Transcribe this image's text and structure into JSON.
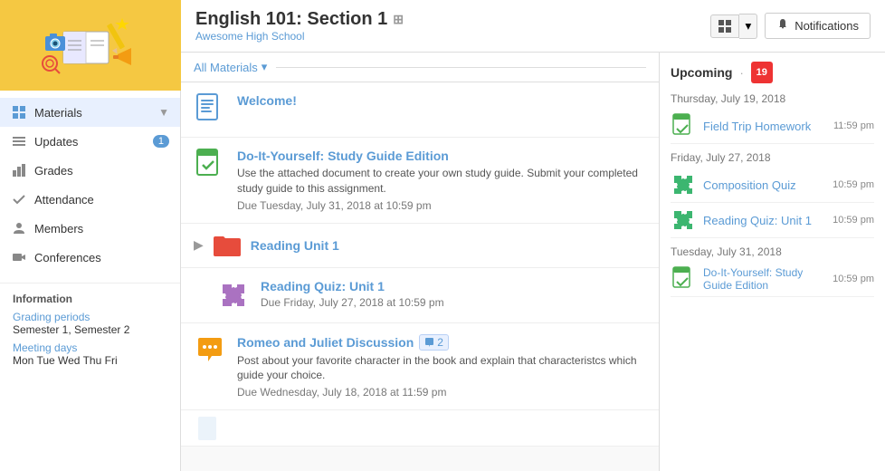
{
  "sidebar": {
    "nav": [
      {
        "id": "materials",
        "label": "Materials",
        "icon": "grid-icon",
        "badge": null,
        "active": true,
        "hasArrow": true
      },
      {
        "id": "updates",
        "label": "Updates",
        "icon": "list-icon",
        "badge": "1",
        "active": false
      },
      {
        "id": "grades",
        "label": "Grades",
        "icon": "chart-icon",
        "badge": null,
        "active": false
      },
      {
        "id": "attendance",
        "label": "Attendance",
        "icon": "check-icon",
        "badge": null,
        "active": false
      },
      {
        "id": "members",
        "label": "Members",
        "icon": "person-icon",
        "badge": null,
        "active": false
      },
      {
        "id": "conferences",
        "label": "Conferences",
        "icon": "video-icon",
        "badge": null,
        "active": false
      }
    ],
    "info_title": "Information",
    "grading_periods_label": "Grading periods",
    "grading_periods_value": "Semester 1, Semester 2",
    "meeting_days_label": "Meeting days",
    "meeting_days_value": "Mon Tue Wed Thu Fri"
  },
  "header": {
    "course_title": "English 101: Section 1",
    "school_name": "Awesome High School",
    "grid_button_label": "grid-view",
    "notifications_label": "Notifications"
  },
  "materials": {
    "all_materials_label": "All Materials",
    "items": [
      {
        "id": "welcome",
        "type": "document",
        "title": "Welcome!",
        "desc": null,
        "due": null,
        "icon_color": "#5b9bd5",
        "comment_count": null
      },
      {
        "id": "study-guide",
        "type": "assignment",
        "title": "Do-It-Yourself: Study Guide Edition",
        "desc": "Use the attached document to create your own study guide. Submit your completed study guide to this assignment.",
        "due": "Due Tuesday, July 31, 2018 at 10:59 pm",
        "icon_color": "#4caf50",
        "comment_count": null
      },
      {
        "id": "reading-unit-1",
        "type": "folder",
        "title": "Reading Unit 1",
        "desc": null,
        "due": null,
        "icon_color": "#e74c3c",
        "comment_count": null
      },
      {
        "id": "reading-quiz-unit-1",
        "type": "quiz",
        "title": "Reading Quiz: Unit 1",
        "desc": null,
        "due": "Due Friday, July 27, 2018 at 10:59 pm",
        "icon_color": "#9b59b6",
        "comment_count": null
      },
      {
        "id": "romeo-juliet",
        "type": "discussion",
        "title": "Romeo and Juliet Discussion",
        "desc": "Post about your favorite character in the book and explain that characteristcs which guide your choice.",
        "due": "Due Wednesday, July 18, 2018 at 11:59 pm",
        "icon_color": "#f39c12",
        "comment_count": "2"
      }
    ]
  },
  "upcoming": {
    "title": "Upcoming",
    "calendar_day": "19",
    "dates": [
      {
        "date": "Thursday, July 19, 2018",
        "items": [
          {
            "title": "Field Trip Homework",
            "time": "11:59 pm",
            "type": "assignment"
          }
        ]
      },
      {
        "date": "Friday, July 27, 2018",
        "items": [
          {
            "title": "Composition Quiz",
            "time": "10:59 pm",
            "type": "quiz"
          },
          {
            "title": "Reading Quiz: Unit 1",
            "time": "10:59 pm",
            "type": "quiz"
          }
        ]
      },
      {
        "date": "Tuesday, July 31, 2018",
        "items": [
          {
            "title": "Do-It-Yourself: Study Guide Edition",
            "time": "10:59 pm",
            "type": "assignment"
          }
        ]
      }
    ]
  }
}
